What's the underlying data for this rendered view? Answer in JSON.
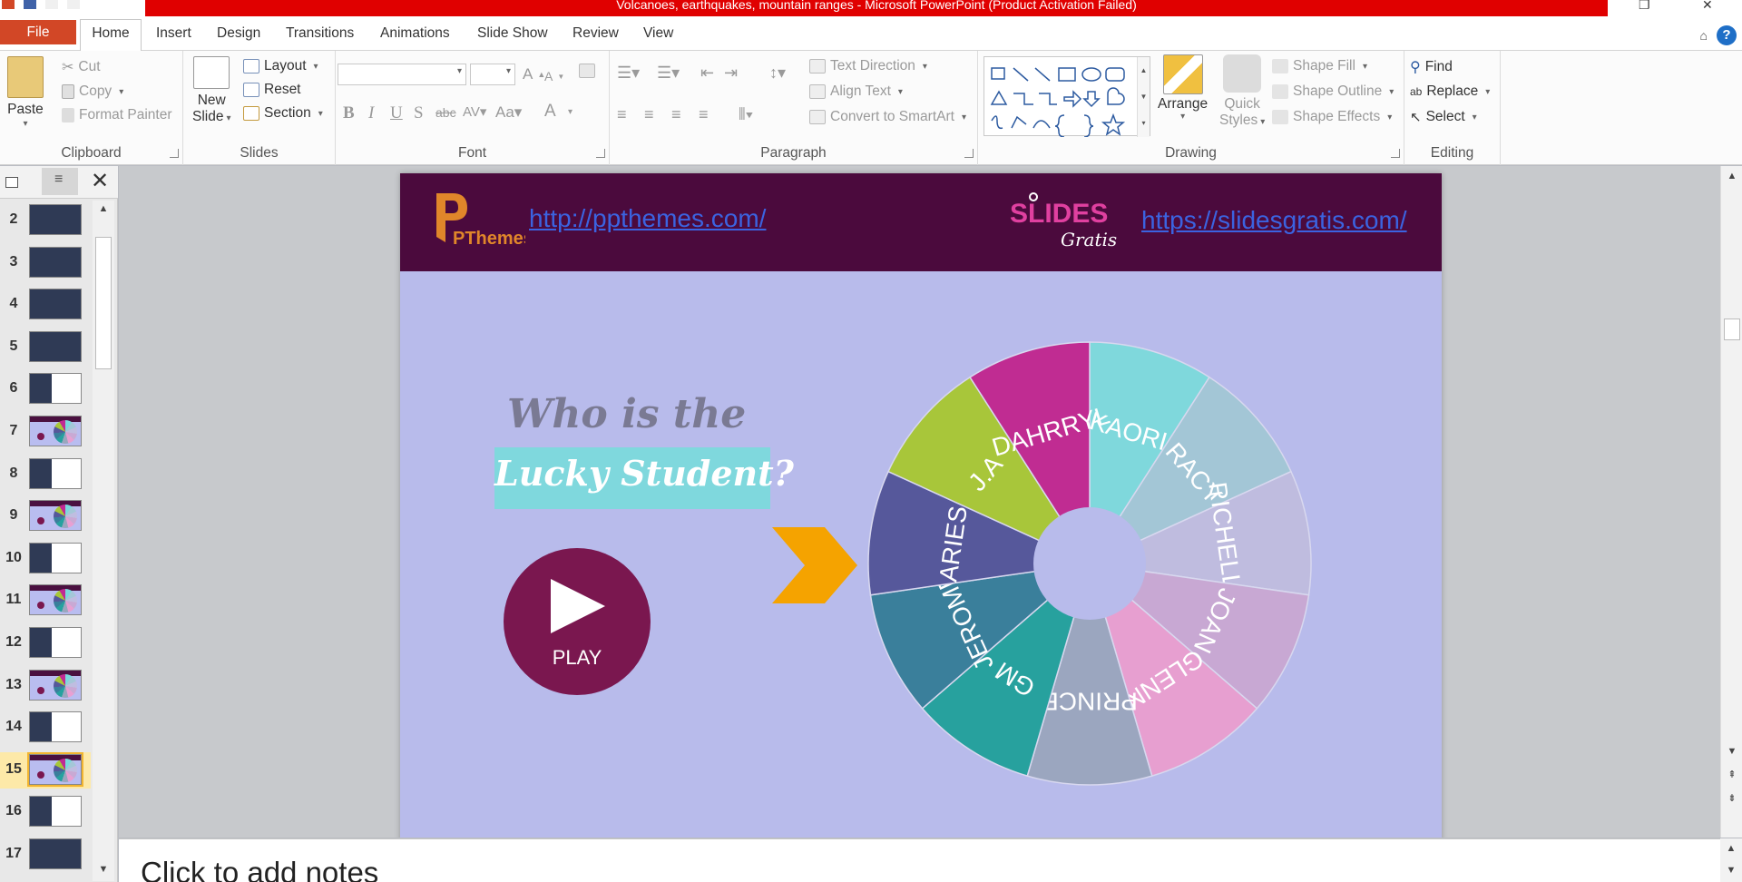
{
  "window": {
    "title": "Volcanoes, earthquakes, mountain ranges - Microsoft PowerPoint (Product Activation Failed)"
  },
  "tabs": [
    "File",
    "Home",
    "Insert",
    "Design",
    "Transitions",
    "Animations",
    "Slide Show",
    "Review",
    "View"
  ],
  "ribbon": {
    "clipboard": {
      "label": "Clipboard",
      "paste": "Paste",
      "cut": "Cut",
      "copy": "Copy",
      "format_painter": "Format Painter"
    },
    "slides": {
      "label": "Slides",
      "new_slide_1": "New",
      "new_slide_2": "Slide",
      "layout": "Layout",
      "reset": "Reset",
      "section": "Section"
    },
    "font": {
      "label": "Font",
      "font_name": "",
      "font_size": ""
    },
    "paragraph": {
      "label": "Paragraph",
      "text_direction": "Text Direction",
      "align_text": "Align Text",
      "convert_smartart": "Convert to SmartArt"
    },
    "drawing": {
      "label": "Drawing",
      "arrange": "Arrange",
      "quick_styles_1": "Quick",
      "quick_styles_2": "Styles",
      "shape_fill": "Shape Fill",
      "shape_outline": "Shape Outline",
      "shape_effects": "Shape Effects"
    },
    "editing": {
      "label": "Editing",
      "find": "Find",
      "replace": "Replace",
      "select": "Select"
    }
  },
  "slide_pane": {
    "thumbnails": [
      {
        "num": "2",
        "style": "dark"
      },
      {
        "num": "3",
        "style": "dark"
      },
      {
        "num": "4",
        "style": "dark"
      },
      {
        "num": "5",
        "style": "dark"
      },
      {
        "num": "6",
        "style": "white"
      },
      {
        "num": "7",
        "style": "lav"
      },
      {
        "num": "8",
        "style": "white"
      },
      {
        "num": "9",
        "style": "lav"
      },
      {
        "num": "10",
        "style": "white"
      },
      {
        "num": "11",
        "style": "lav"
      },
      {
        "num": "12",
        "style": "white"
      },
      {
        "num": "13",
        "style": "lav"
      },
      {
        "num": "14",
        "style": "white"
      },
      {
        "num": "15",
        "style": "lav",
        "active": true
      },
      {
        "num": "16",
        "style": "white"
      },
      {
        "num": "17",
        "style": "dark"
      }
    ]
  },
  "slide": {
    "header_bg": "#4b0a3d",
    "body_bg": "#b8bbeb",
    "link_left": "http://ppthemes.com/",
    "link_right": "https://slidesgratis.com/",
    "logo_left_text": "PThemes",
    "logo_right_text_1": "SLIDES",
    "logo_right_text_2": "Gratis",
    "title_line1": "Who is the",
    "title_line2": "Lucky Student?",
    "play_label": "PLAY",
    "wheel_names": [
      "KAORI",
      "RACY",
      "RICHELLE",
      "JOAN",
      "GLENN",
      "PRINCE",
      "GM",
      "JEROME",
      "ARIES",
      "J.A",
      "DAHRRYL"
    ],
    "wheel_colors": [
      "#7fd8dc",
      "#a3c6d6",
      "#bfbcdf",
      "#c8a8d3",
      "#e79fd0",
      "#9ba6bf",
      "#27a19e",
      "#3a7f9b",
      "#56589b",
      "#a8c63a",
      "#c02c92"
    ],
    "pointer_color": "#f5a300"
  },
  "notes": {
    "placeholder": "Click to add notes"
  }
}
